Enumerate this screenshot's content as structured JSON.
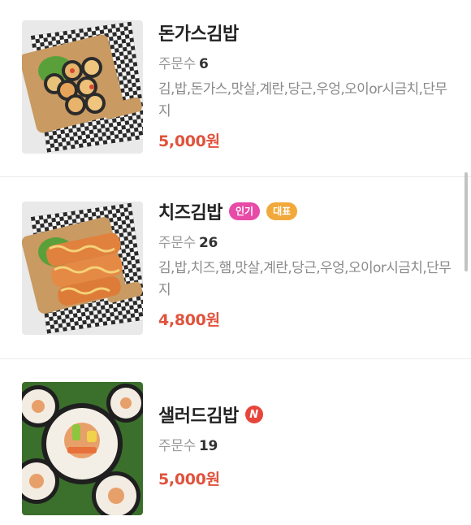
{
  "colors": {
    "price": "#e0533d",
    "badge_popular": "#e84aa7",
    "badge_signature": "#f2a93b",
    "badge_new": "#e8453a"
  },
  "menu": [
    {
      "name": "돈가스김밥",
      "orders_label": "주문수",
      "orders_count": "6",
      "description": "김,밥,돈가스,맛살,계란,당근,우엉,오이or시금치,단무지",
      "price": "5,000원",
      "image_icon": "tonkatsu-gimbap-photo"
    },
    {
      "name": "치즈김밥",
      "badges": [
        "인기",
        "대표"
      ],
      "orders_label": "주문수",
      "orders_count": "26",
      "description": "김,밥,치즈,햄,맛살,계란,당근,우엉,오이or시금치,단무지",
      "price": "4,800원",
      "image_icon": "cheese-gimbap-photo"
    },
    {
      "name": "샐러드김밥",
      "new_badge": "N",
      "orders_label": "주문수",
      "orders_count": "19",
      "price": "5,000원",
      "image_icon": "salad-gimbap-photo"
    }
  ]
}
